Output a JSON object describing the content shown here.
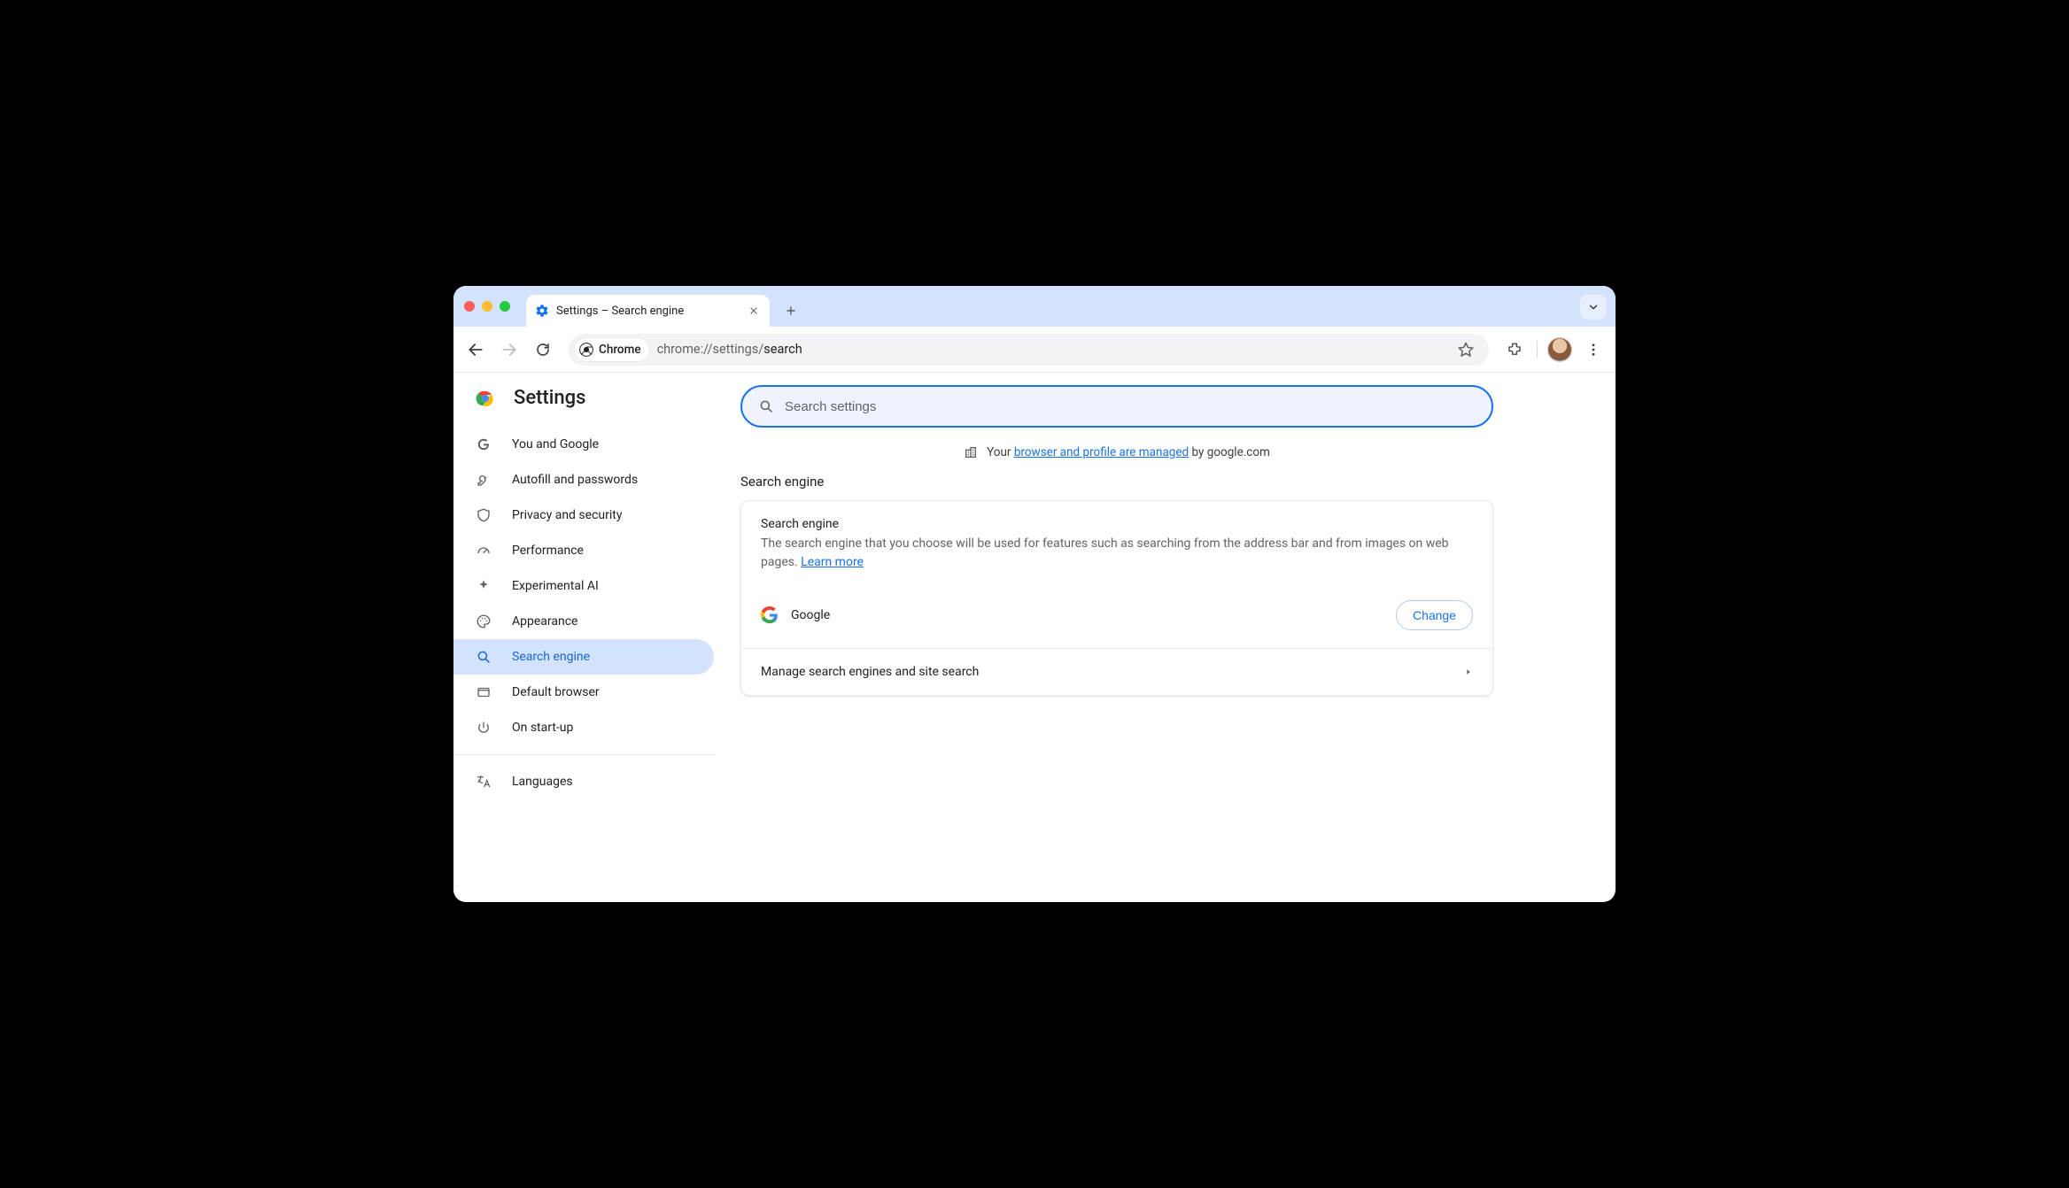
{
  "tab": {
    "title": "Settings – Search engine"
  },
  "omnibox": {
    "chip_label": "Chrome",
    "url_prefix": "chrome://settings/",
    "url_path": "search"
  },
  "sidebar": {
    "title": "Settings",
    "items": [
      {
        "label": "You and Google"
      },
      {
        "label": "Autofill and passwords"
      },
      {
        "label": "Privacy and security"
      },
      {
        "label": "Performance"
      },
      {
        "label": "Experimental AI"
      },
      {
        "label": "Appearance"
      },
      {
        "label": "Search engine"
      },
      {
        "label": "Default browser"
      },
      {
        "label": "On start-up"
      }
    ],
    "items2": [
      {
        "label": "Languages"
      }
    ]
  },
  "search": {
    "placeholder": "Search settings"
  },
  "managed": {
    "prefix": "Your ",
    "link": "browser and profile are managed",
    "suffix": " by google.com"
  },
  "section": {
    "title": "Search engine"
  },
  "card": {
    "label": "Search engine",
    "desc": "The search engine that you choose will be used for features such as searching from the address bar and from images on web pages. ",
    "learn_more": "Learn more",
    "engine_name": "Google",
    "change": "Change",
    "manage_row": "Manage search engines and site search"
  }
}
